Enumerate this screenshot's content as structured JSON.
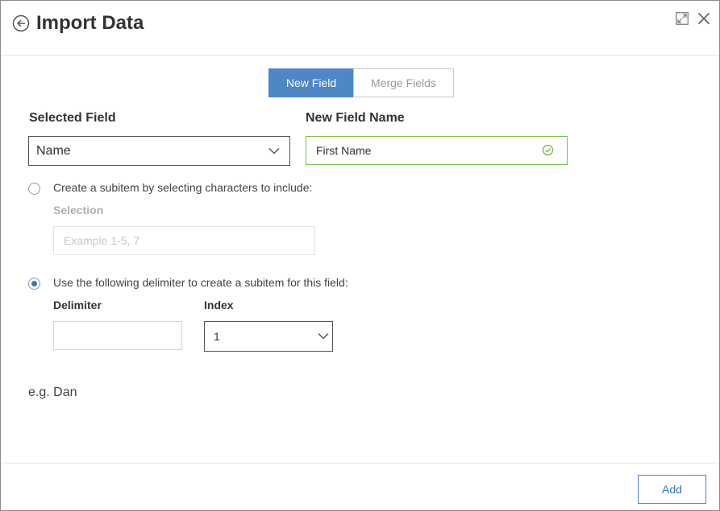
{
  "header": {
    "title": "Import Data",
    "back_icon": "arrow-left-circle-icon",
    "expand_icon": "expand-icon",
    "close_icon": "close-icon"
  },
  "mode_toggle": {
    "options": [
      "New Field",
      "Merge Fields"
    ],
    "selected": "New Field"
  },
  "selected_field": {
    "label": "Selected Field",
    "value": "Name"
  },
  "new_field_name": {
    "label": "New Field Name",
    "value": "First Name",
    "valid": true
  },
  "option_characters": {
    "text": "Create a subitem by selecting characters to include:",
    "selected": false,
    "selection_label": "Selection",
    "selection_placeholder": "Example 1-5, 7"
  },
  "option_delimiter": {
    "text": "Use the following delimiter to create a subitem for this field:",
    "selected": true,
    "delimiter_label": "Delimiter",
    "delimiter_value": "",
    "index_label": "Index",
    "index_value": "1"
  },
  "example_text": "e.g. Dan",
  "footer": {
    "add_label": "Add"
  },
  "colors": {
    "accent": "#4f86c6",
    "valid": "#7cbf48"
  }
}
